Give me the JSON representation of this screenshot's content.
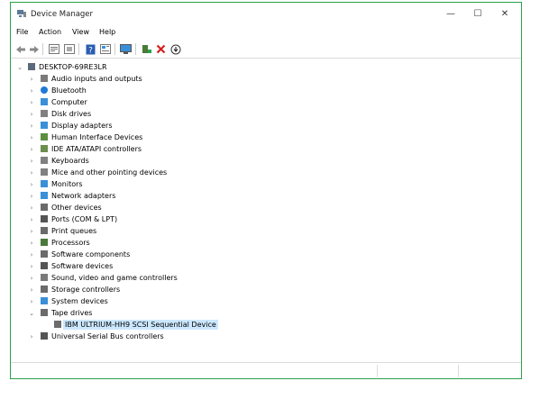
{
  "window": {
    "title": "Device Manager",
    "controls": {
      "minimize": "—",
      "maximize": "☐",
      "close": "✕"
    }
  },
  "menu": [
    "File",
    "Action",
    "View",
    "Help"
  ],
  "toolbar_icons": [
    "back-arrow-icon",
    "forward-arrow-icon",
    "properties-icon",
    "show-hide-icon",
    "help-icon",
    "driver-icon",
    "computer-monitor-icon",
    "add-driver-icon",
    "uninstall-icon",
    "download-icon"
  ],
  "tree": {
    "root": "DESKTOP-69RE3LR",
    "categories": [
      {
        "label": "Audio inputs and outputs",
        "icon": "speaker-icon",
        "color": "#7a7a7a",
        "expanded": false
      },
      {
        "label": "Bluetooth",
        "icon": "bluetooth-icon",
        "color": "#1e7ad6",
        "expanded": false
      },
      {
        "label": "Computer",
        "icon": "computer-icon",
        "color": "#3a8fd9",
        "expanded": false
      },
      {
        "label": "Disk drives",
        "icon": "disk-drive-icon",
        "color": "#808080",
        "expanded": false
      },
      {
        "label": "Display adapters",
        "icon": "display-adapter-icon",
        "color": "#3a8fd9",
        "expanded": false
      },
      {
        "label": "Human Interface Devices",
        "icon": "hid-icon",
        "color": "#5b8f3e",
        "expanded": false
      },
      {
        "label": "IDE ATA/ATAPI controllers",
        "icon": "ide-controller-icon",
        "color": "#6b8f4e",
        "expanded": false
      },
      {
        "label": "Keyboards",
        "icon": "keyboard-icon",
        "color": "#808080",
        "expanded": false
      },
      {
        "label": "Mice and other pointing devices",
        "icon": "mouse-icon",
        "color": "#808080",
        "expanded": false
      },
      {
        "label": "Monitors",
        "icon": "monitor-icon",
        "color": "#3a8fd9",
        "expanded": false
      },
      {
        "label": "Network adapters",
        "icon": "network-adapter-icon",
        "color": "#3a8fd9",
        "expanded": false
      },
      {
        "label": "Other devices",
        "icon": "other-devices-icon",
        "color": "#6b6b6b",
        "expanded": false
      },
      {
        "label": "Ports (COM & LPT)",
        "icon": "port-icon",
        "color": "#555555",
        "expanded": false
      },
      {
        "label": "Print queues",
        "icon": "printer-icon",
        "color": "#6b6b6b",
        "expanded": false
      },
      {
        "label": "Processors",
        "icon": "processor-icon",
        "color": "#4a7a3a",
        "expanded": false
      },
      {
        "label": "Software components",
        "icon": "software-component-icon",
        "color": "#6b6b6b",
        "expanded": false
      },
      {
        "label": "Software devices",
        "icon": "software-device-icon",
        "color": "#555555",
        "expanded": false
      },
      {
        "label": "Sound, video and game controllers",
        "icon": "sound-controller-icon",
        "color": "#7a7a7a",
        "expanded": false
      },
      {
        "label": "Storage controllers",
        "icon": "storage-controller-icon",
        "color": "#6b6b6b",
        "expanded": false
      },
      {
        "label": "System devices",
        "icon": "system-device-icon",
        "color": "#3a8fd9",
        "expanded": false
      },
      {
        "label": "Tape drives",
        "icon": "tape-drive-icon",
        "color": "#6b6b6b",
        "expanded": true,
        "children": [
          {
            "label": "IBM ULTRIUM-HH9 SCSI Sequential Device",
            "icon": "tape-device-icon",
            "selected": true
          }
        ]
      },
      {
        "label": "Universal Serial Bus controllers",
        "icon": "usb-icon",
        "color": "#555555",
        "expanded": false
      }
    ]
  },
  "colors": {
    "window_border": "#2aa14a",
    "selection": "#cce8ff"
  }
}
